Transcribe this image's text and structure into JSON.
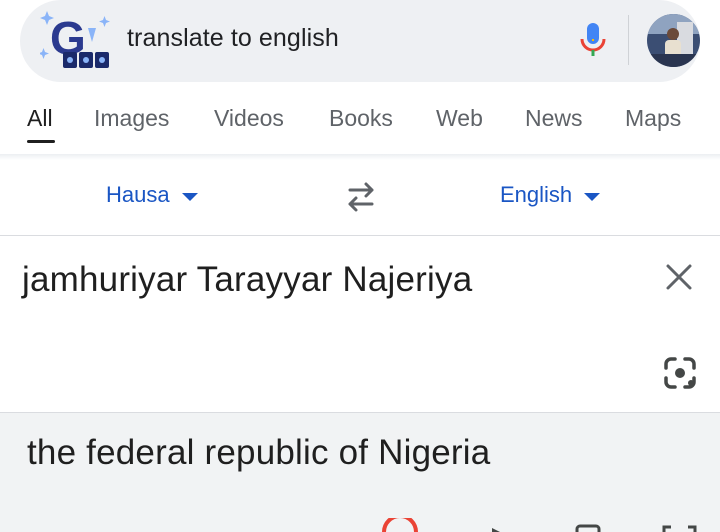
{
  "search": {
    "query": "translate to english"
  },
  "icons": {
    "logo": "google-doodle-logo",
    "mic": "microphone-icon",
    "avatar": "user-avatar",
    "swap": "swap-arrows-icon",
    "clear": "close-icon",
    "lens": "camera-lens-icon"
  },
  "tabs": [
    {
      "label": "All",
      "active": true
    },
    {
      "label": "Images"
    },
    {
      "label": "Videos"
    },
    {
      "label": "Books"
    },
    {
      "label": "Web"
    },
    {
      "label": "News"
    },
    {
      "label": "Maps"
    }
  ],
  "translator": {
    "source_lang": "Hausa",
    "target_lang": "English",
    "source_text": "jamhuriyar Tarayyar Najeriya",
    "result_text": "the federal republic of Nigeria"
  },
  "colors": {
    "accent": "#1a56c4",
    "search_bg": "#eef0f3",
    "result_bg": "#f1f3f4"
  }
}
